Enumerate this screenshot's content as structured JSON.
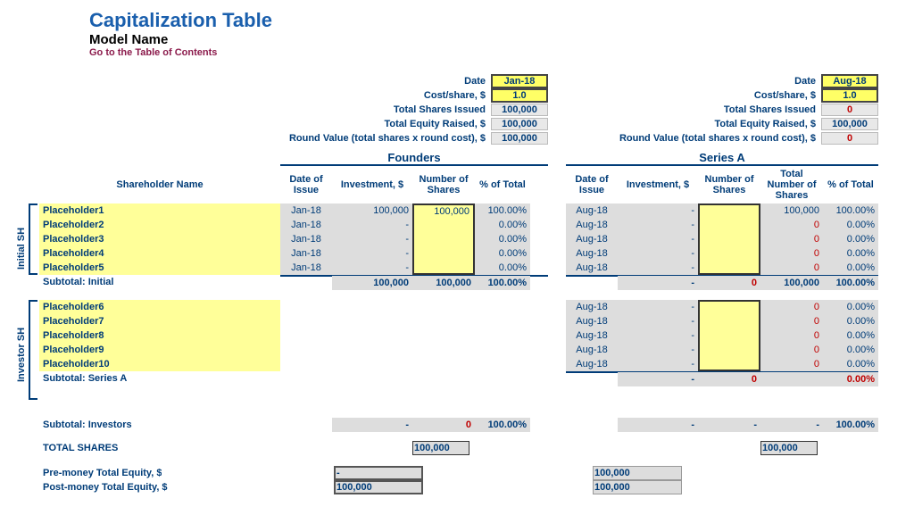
{
  "header": {
    "title": "Capitalization Table",
    "model_name": "Model Name",
    "toc": "Go to the Table of Contents"
  },
  "labels": {
    "date": "Date",
    "cost_share": "Cost/share, $",
    "total_shares_issued": "Total Shares Issued",
    "total_equity_raised": "Total Equity Raised, $",
    "round_value": "Round Value (total shares x round cost), $",
    "shareholder_name": "Shareholder Name",
    "date_of_issue": "Date of Issue",
    "investment": "Investment, $",
    "number_of_shares": "Number of Shares",
    "total_number_of_shares": "Total Number of Shares",
    "pct_of_total": "% of Total",
    "initial_sh": "Initial SH",
    "investor_sh": "Investor SH",
    "subtotal_initial": "Subtotal: Initial",
    "subtotal_series_a": "Subtotal: Series A",
    "subtotal_investors": "Subtotal: Investors",
    "total_shares": "TOTAL SHARES",
    "pre_money": "Pre-money Total Equity, $",
    "post_money": "Post-money Total Equity, $"
  },
  "rounds": {
    "founders": {
      "title": "Founders",
      "date": "Jan-18",
      "cost": "1.0",
      "shares_issued": "100,000",
      "equity_raised": "100,000",
      "round_value": "100,000",
      "rows": [
        {
          "name": "Placeholder1",
          "date": "Jan-18",
          "inv": "100,000",
          "num": "100,000",
          "pct": "100.00%"
        },
        {
          "name": "Placeholder2",
          "date": "Jan-18",
          "inv": "-",
          "num": "",
          "pct": "0.00%"
        },
        {
          "name": "Placeholder3",
          "date": "Jan-18",
          "inv": "-",
          "num": "",
          "pct": "0.00%"
        },
        {
          "name": "Placeholder4",
          "date": "Jan-18",
          "inv": "-",
          "num": "",
          "pct": "0.00%"
        },
        {
          "name": "Placeholder5",
          "date": "Jan-18",
          "inv": "-",
          "num": "",
          "pct": "0.00%"
        }
      ],
      "subtotal": {
        "inv": "100,000",
        "num": "100,000",
        "pct": "100.00%"
      },
      "sub_investors": {
        "inv": "-",
        "num": "0",
        "pct": "100.00%"
      },
      "total_shares_box": "100,000",
      "pre_money": "-",
      "post_money": "100,000"
    },
    "series_a": {
      "title": "Series A",
      "date": "Aug-18",
      "cost": "1.0",
      "shares_issued": "0",
      "equity_raised": "100,000",
      "round_value": "0",
      "rows_initial": [
        {
          "date": "Aug-18",
          "inv": "-",
          "num": "",
          "tot": "100,000",
          "pct": "100.00%"
        },
        {
          "date": "Aug-18",
          "inv": "-",
          "num": "",
          "tot": "0",
          "pct": "0.00%"
        },
        {
          "date": "Aug-18",
          "inv": "-",
          "num": "",
          "tot": "0",
          "pct": "0.00%"
        },
        {
          "date": "Aug-18",
          "inv": "-",
          "num": "",
          "tot": "0",
          "pct": "0.00%"
        },
        {
          "date": "Aug-18",
          "inv": "-",
          "num": "",
          "tot": "0",
          "pct": "0.00%"
        }
      ],
      "subtotal_initial": {
        "inv": "-",
        "num": "0",
        "tot": "100,000",
        "pct": "100.00%"
      },
      "rows_investor_names": [
        "Placeholder6",
        "Placeholder7",
        "Placeholder8",
        "Placeholder9",
        "Placeholder10"
      ],
      "rows_investor": [
        {
          "date": "Aug-18",
          "inv": "-",
          "num": "",
          "tot": "0",
          "pct": "0.00%"
        },
        {
          "date": "Aug-18",
          "inv": "-",
          "num": "",
          "tot": "0",
          "pct": "0.00%"
        },
        {
          "date": "Aug-18",
          "inv": "-",
          "num": "",
          "tot": "0",
          "pct": "0.00%"
        },
        {
          "date": "Aug-18",
          "inv": "-",
          "num": "",
          "tot": "0",
          "pct": "0.00%"
        },
        {
          "date": "Aug-18",
          "inv": "-",
          "num": "",
          "tot": "0",
          "pct": "0.00%"
        }
      ],
      "subtotal_series_a": {
        "inv": "-",
        "num": "0",
        "tot": "",
        "pct": "0.00%"
      },
      "sub_investors": {
        "inv": "-",
        "num": "-",
        "tot": "-",
        "pct": "100.00%"
      },
      "total_shares_box": "100,000",
      "pre_money": "100,000",
      "post_money": "100,000"
    }
  }
}
